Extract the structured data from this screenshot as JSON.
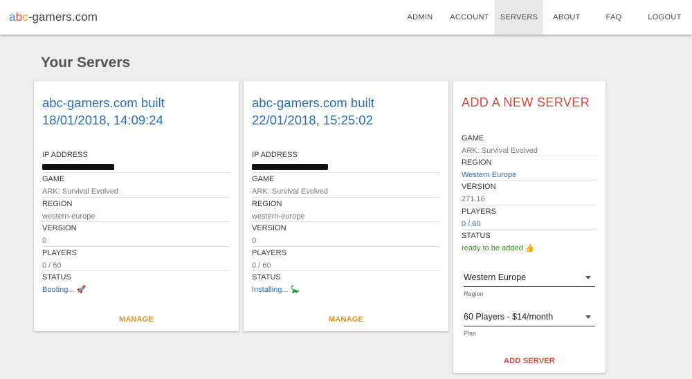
{
  "brand": {
    "a": "a",
    "b": "b",
    "c": "c",
    "rest": "-gamers.com"
  },
  "nav": [
    "ADMIN",
    "ACCOUNT",
    "SERVERS",
    "ABOUT",
    "FAQ",
    "LOGOUT"
  ],
  "page_title": "Your Servers",
  "servers": [
    {
      "title": "abc-gamers.com built 18/01/2018, 14:09:24",
      "ip_label": "IP ADDRESS",
      "game_label": "GAME",
      "game": "ARK: Survival Evolved",
      "region_label": "REGION",
      "region": "western-europe",
      "version_label": "VERSION",
      "version": "0",
      "players_label": "PLAYERS",
      "players": "0 / 60",
      "status_label": "STATUS",
      "status": "Booting...",
      "status_emoji": "🚀",
      "manage": "MANAGE"
    },
    {
      "title": "abc-gamers.com built 22/01/2018, 15:25:02",
      "ip_label": "IP ADDRESS",
      "game_label": "GAME",
      "game": "ARK: Survival Evolved",
      "region_label": "REGION",
      "region": "western-europe",
      "version_label": "VERSION",
      "version": "0",
      "players_label": "PLAYERS",
      "players": "0 / 60",
      "status_label": "STATUS",
      "status": "Installing...",
      "status_emoji": "🦕",
      "manage": "MANAGE"
    }
  ],
  "add": {
    "title": "ADD A NEW SERVER",
    "game_label": "GAME",
    "game": "ARK: Survival Evolved",
    "region_label": "REGION",
    "region": "Western Europe",
    "version_label": "VERSION",
    "version": "271.16",
    "players_label": "PLAYERS",
    "players": "0 / 60",
    "status_label": "STATUS",
    "status": "ready to be added",
    "status_emoji": "👍",
    "region_select": "Western Europe",
    "region_hint": "Region",
    "plan_select": "60 Players - $14/month",
    "plan_hint": "Plan",
    "button": "ADD SERVER"
  },
  "colors": {
    "accent_blue": "#2a6fb5",
    "accent_red": "#d24a3a",
    "manage_orange": "#e09020",
    "ready_green": "#3b8c2a"
  }
}
